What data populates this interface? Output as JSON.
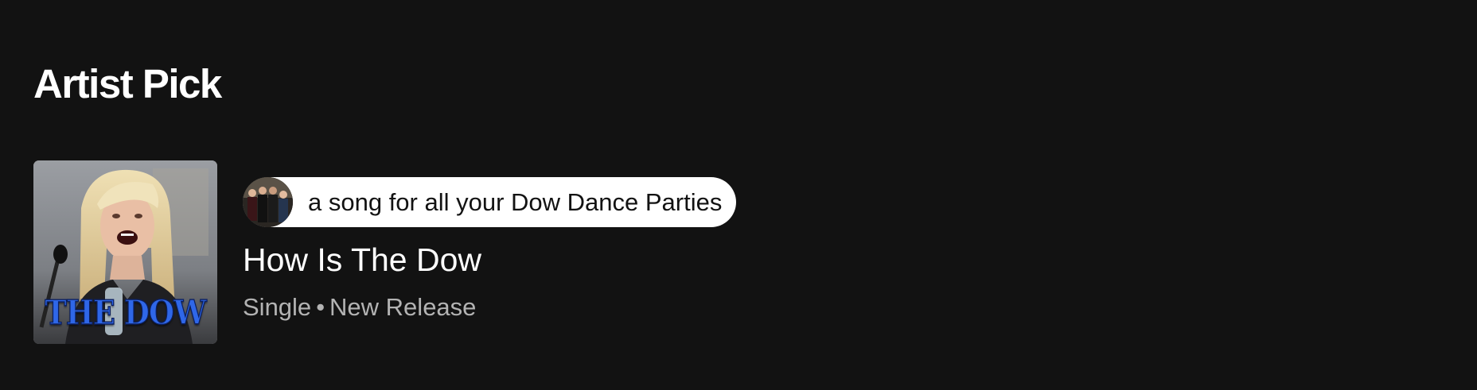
{
  "section": {
    "title": "Artist Pick"
  },
  "pick": {
    "cover": {
      "overlay_text": "THE DOW",
      "icon": "album-cover-image"
    },
    "comment": {
      "avatar_icon": "artist-avatar-image",
      "text": "a song for all your Dow Dance Parties"
    },
    "title": "How Is The Dow",
    "release_type": "Single",
    "separator": "•",
    "release_label": "New Release"
  },
  "colors": {
    "background": "#121212",
    "text_primary": "#ffffff",
    "text_secondary": "#b3b3b3",
    "pill_background": "#ffffff",
    "pill_text": "#121212",
    "cover_text": "#2f67e8"
  }
}
